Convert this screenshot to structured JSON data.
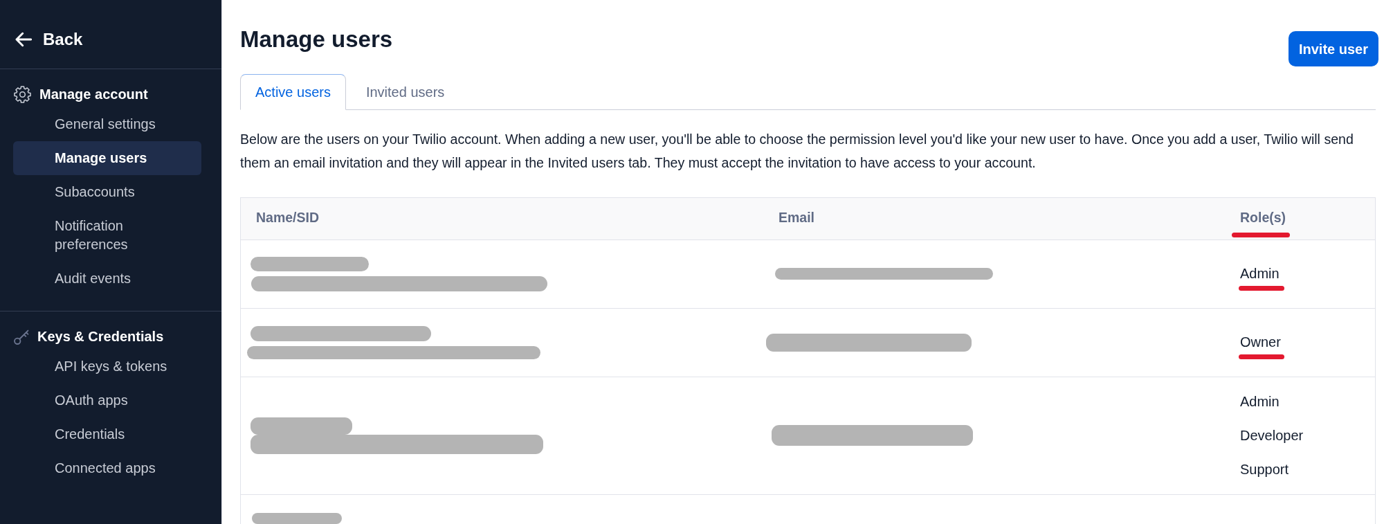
{
  "sidebar": {
    "back": {
      "label": "Back"
    },
    "sections": [
      {
        "kind": "account",
        "title": "Manage account",
        "items": [
          {
            "label": "General settings",
            "selected": false
          },
          {
            "label": "Manage users",
            "selected": true
          },
          {
            "label": "Subaccounts",
            "selected": false
          },
          {
            "label": "Notification preferences",
            "selected": false
          },
          {
            "label": "Audit events",
            "selected": false
          }
        ]
      },
      {
        "kind": "keys",
        "title": "Keys & Credentials",
        "items": [
          {
            "label": "API keys & tokens",
            "selected": false
          },
          {
            "label": "OAuth apps",
            "selected": false
          },
          {
            "label": "Credentials",
            "selected": false
          },
          {
            "label": "Connected apps",
            "selected": false
          }
        ]
      }
    ]
  },
  "page": {
    "title": "Manage users",
    "invite_button": "Invite user",
    "tabs": [
      {
        "label": "Active users",
        "selected": true
      },
      {
        "label": "Invited users",
        "selected": false
      }
    ],
    "description": "Below are the users on your Twilio account. When adding a new user, you'll be able to choose the permission level you'd like your new user to have. Once you add a user, Twilio will send them an email invitation and they will appear in the Invited users tab. They must accept the invitation to have access to your account."
  },
  "table": {
    "columns": [
      {
        "label": "Name/SID",
        "underlined": false
      },
      {
        "label": "Email",
        "underlined": false
      },
      {
        "label": "Role(s)",
        "underlined": true
      }
    ],
    "rows": [
      {
        "name_redacted": true,
        "email_redacted": true,
        "roles": [
          "Admin"
        ],
        "roles_underlined": true
      },
      {
        "name_redacted": true,
        "email_redacted": true,
        "roles": [
          "Owner"
        ],
        "roles_underlined": true
      },
      {
        "name_redacted": true,
        "email_redacted": true,
        "roles": [
          "Admin",
          "Developer",
          "Support"
        ],
        "roles_underlined": false
      },
      {
        "name_redacted": true,
        "email_redacted": false,
        "roles_underlined": false
      }
    ]
  }
}
